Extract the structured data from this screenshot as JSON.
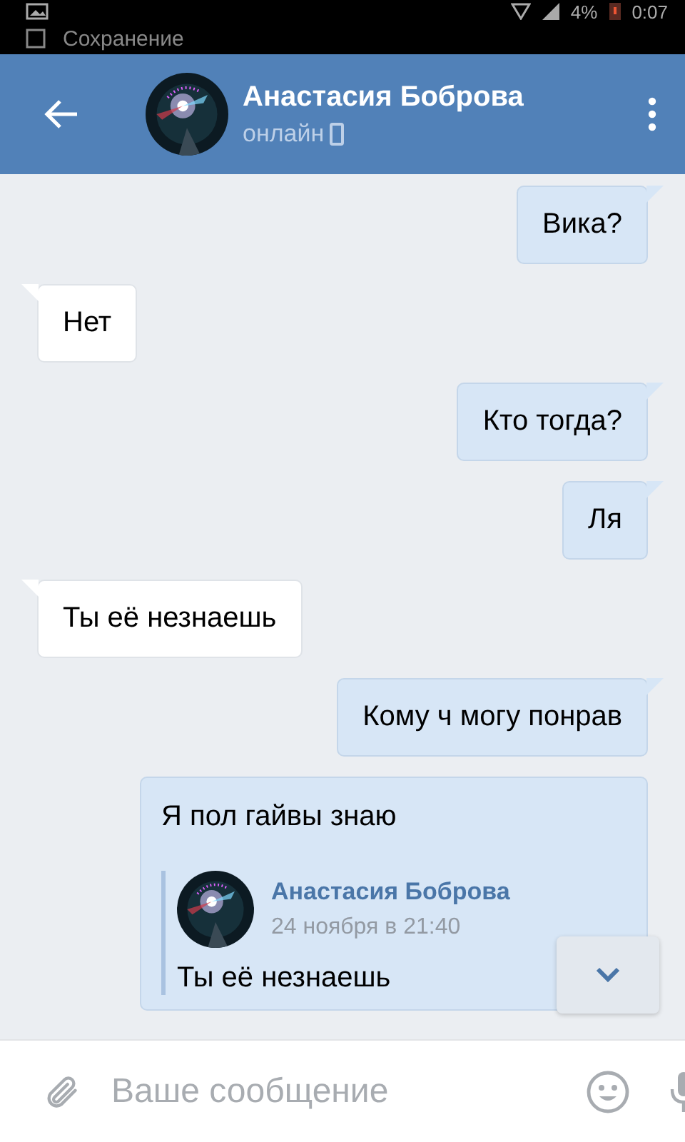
{
  "status_bar": {
    "battery": "4%",
    "time": "0:07"
  },
  "notification": {
    "text": "Сохранение"
  },
  "header": {
    "title": "Анастасия Боброва",
    "status": "онлайн"
  },
  "messages": [
    {
      "kind": "outgoing",
      "text": "Вика?"
    },
    {
      "kind": "incoming",
      "text": "Нет"
    },
    {
      "kind": "outgoing",
      "text": "Кто тогда?"
    },
    {
      "kind": "outgoing",
      "text": "Ля"
    },
    {
      "kind": "incoming",
      "text": "Ты её незнаешь"
    },
    {
      "kind": "outgoing",
      "text": "Кому ч могу понрав"
    },
    {
      "kind": "forwarded",
      "text": "Я пол гайвы знаю",
      "forwarded": {
        "author": "Анастасия Боброва",
        "date": "24 ноября в 21:40",
        "text": "Ты её незнаешь"
      }
    }
  ],
  "composer": {
    "placeholder": "Ваше сообщение"
  }
}
